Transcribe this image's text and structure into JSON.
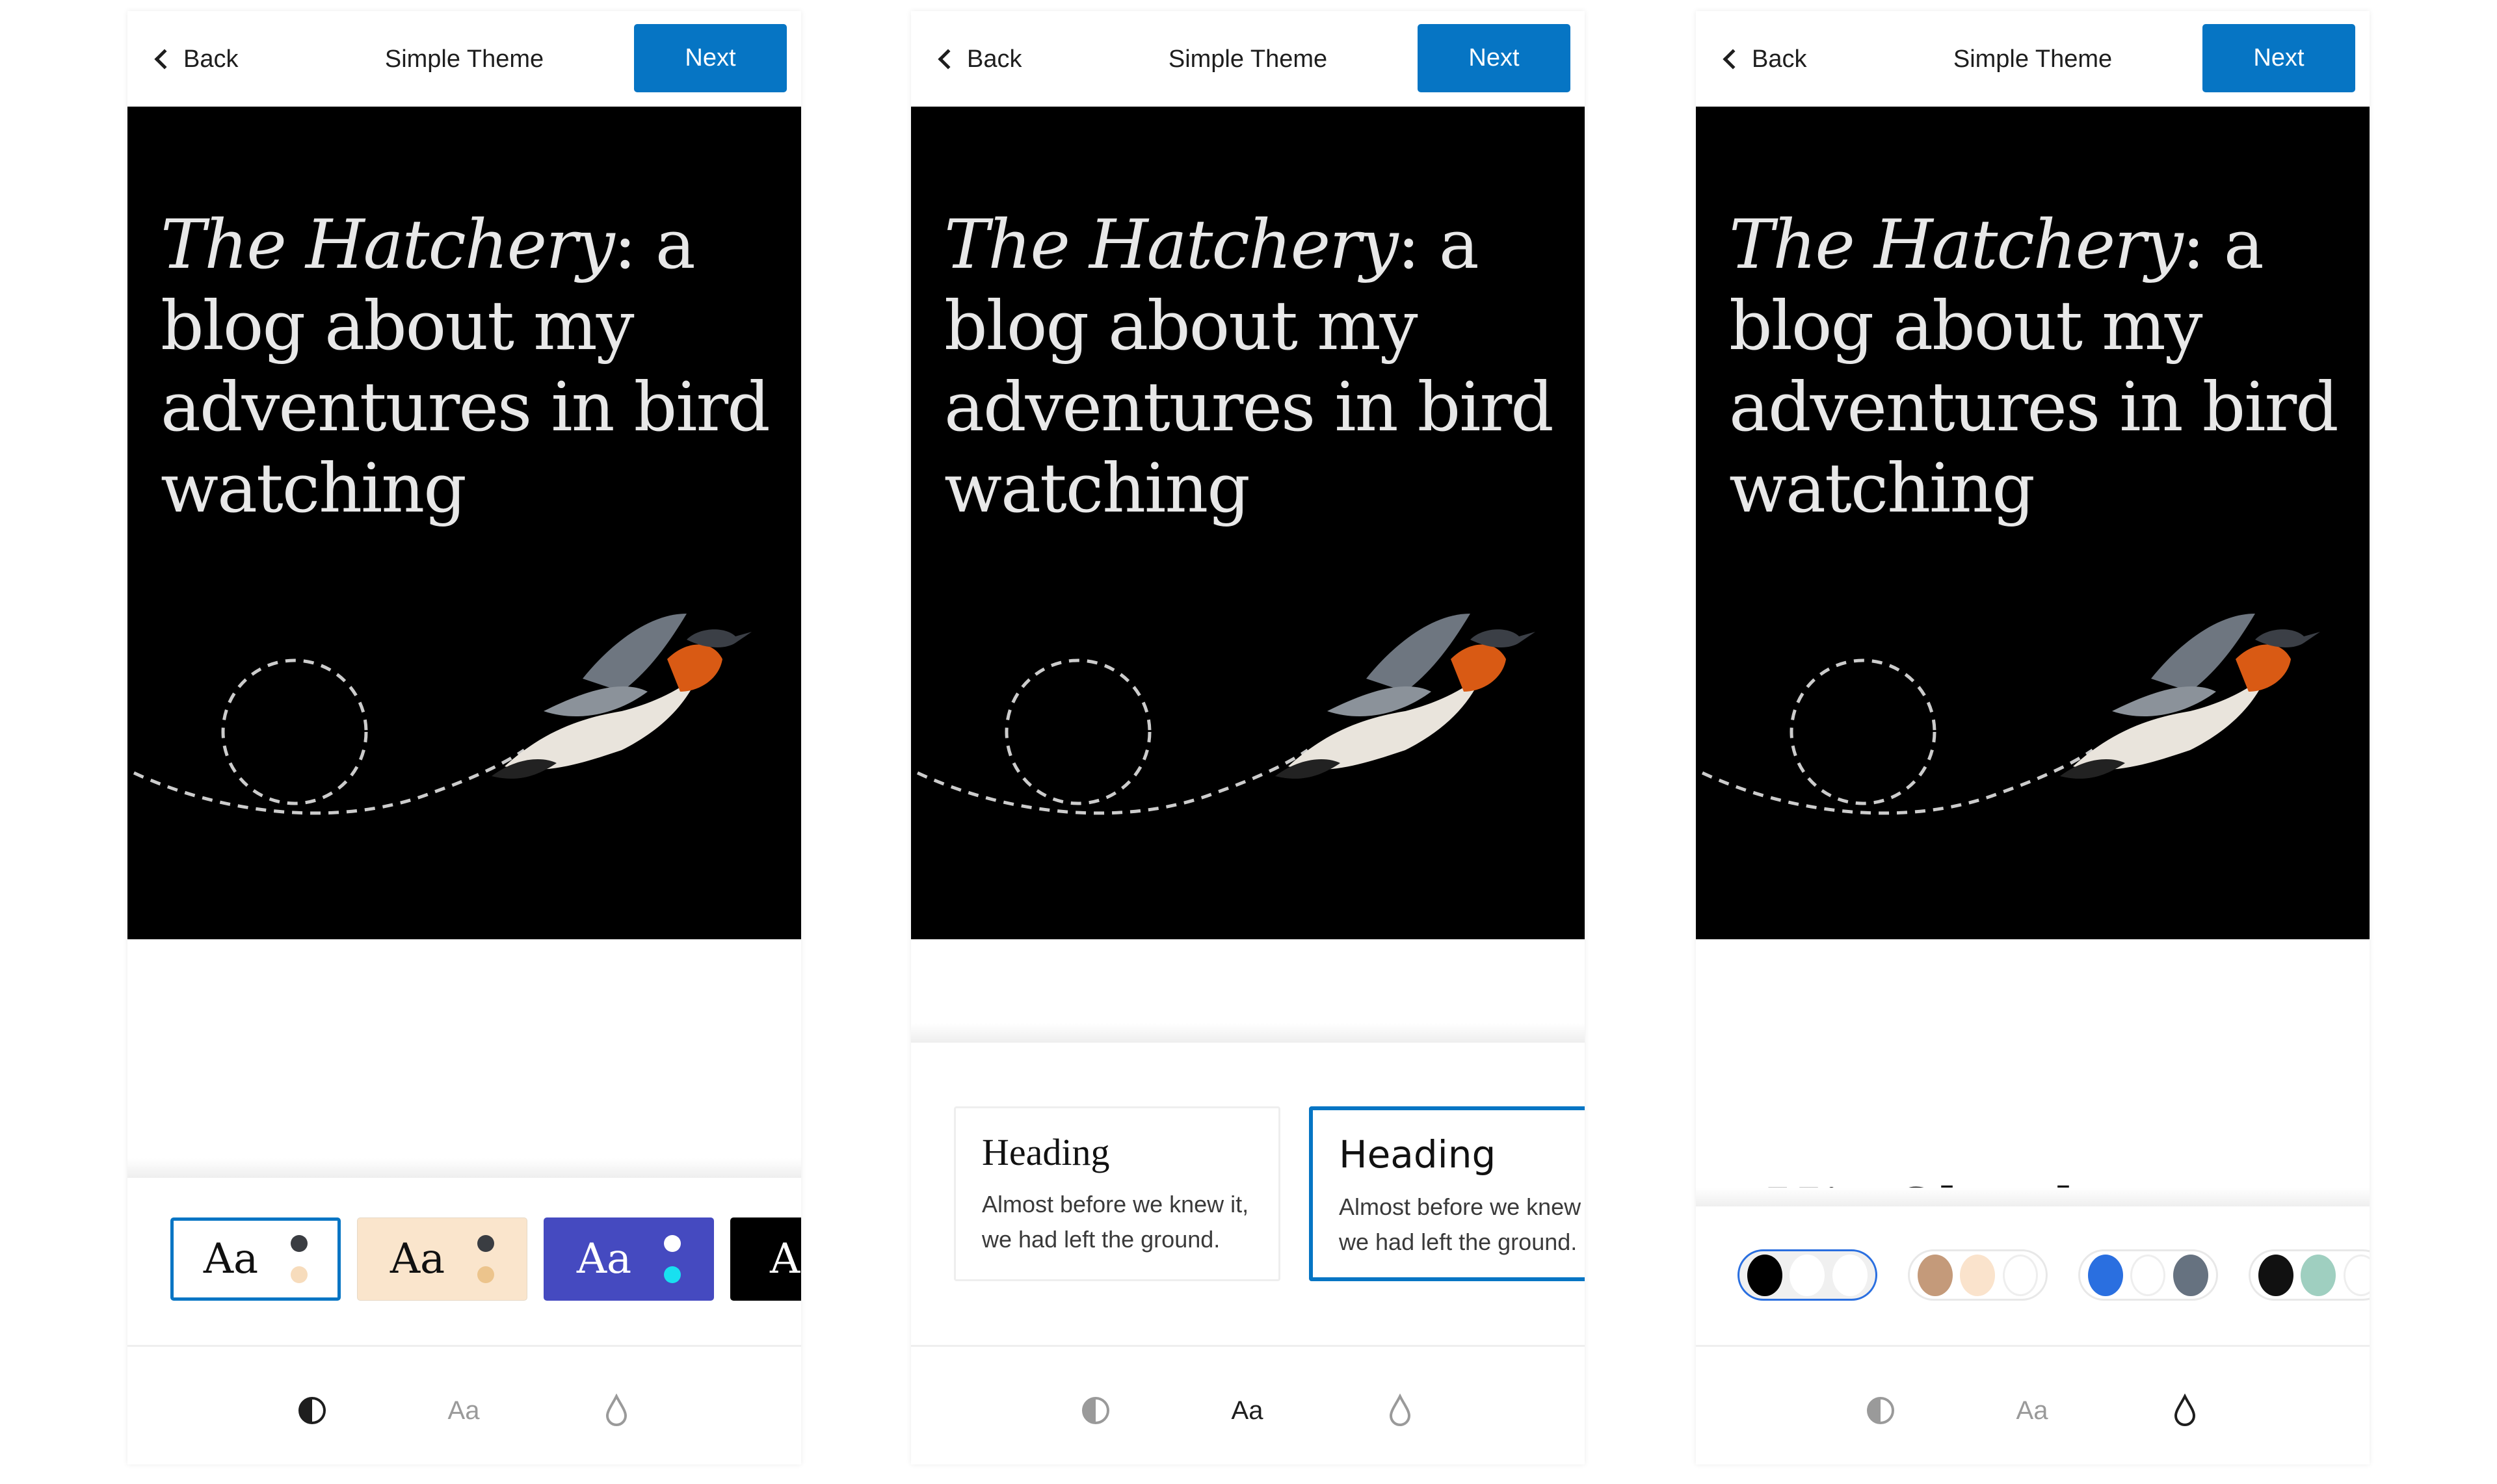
{
  "accent": "#0675c4",
  "panels": [
    {
      "header": {
        "back_label": "Back",
        "title": "Simple Theme",
        "next_label": "Next"
      },
      "hero": {
        "title_italic": "The Hatchery",
        "title_rest": ": a blog about my adventures in bird watching"
      },
      "mode": "styles",
      "styles": [
        {
          "label": "Aa",
          "bg": "#ffffff",
          "fg": "#111111",
          "dots": [
            "#3a3d42",
            "#f7dcbc"
          ],
          "selected": true
        },
        {
          "label": "Aa",
          "bg": "#fae5cc",
          "fg": "#111111",
          "dots": [
            "#3a3d42",
            "#ecc48c"
          ],
          "selected": false
        },
        {
          "label": "Aa",
          "bg": "#454ac0",
          "fg": "#ffffff",
          "dots": [
            "#ffffff",
            "#18e0f0"
          ],
          "selected": false
        },
        {
          "label": "Aa",
          "bg": "#000000",
          "fg": "#ffffff",
          "dots": [],
          "selected": false
        }
      ],
      "toolbar": {
        "active": "contrast-icon",
        "aa_label": "Aa"
      }
    },
    {
      "header": {
        "back_label": "Back",
        "title": "Simple Theme",
        "next_label": "Next"
      },
      "hero": {
        "title_italic": "The Hatchery",
        "title_rest": ": a blog about my adventures in bird watching"
      },
      "mode": "fonts",
      "fonts": [
        {
          "heading": "Heading",
          "body": "Almost before we knew it, we had left the ground.",
          "selected": false
        },
        {
          "heading": "Heading",
          "body": "Almost before we knew it, we had left the ground.",
          "selected": true
        }
      ],
      "toolbar": {
        "active": "typography-icon",
        "aa_label": "Aa"
      }
    },
    {
      "header": {
        "back_label": "Back",
        "title": "Simple Theme",
        "next_label": "Next"
      },
      "hero": {
        "title_italic": "The Hatchery",
        "title_rest": ": a blog about my adventures in bird watching"
      },
      "mode": "colors",
      "preview_text": "Hi! Check out my",
      "palettes": [
        {
          "colors": [
            "#000000",
            "#ffffff",
            "#ffffff"
          ],
          "selected": true
        },
        {
          "colors": [
            "#c49a7a",
            "#fae3cc",
            "#ffffff"
          ],
          "selected": false
        },
        {
          "colors": [
            "#2a6fe0",
            "#ffffff",
            "#667280"
          ],
          "selected": false
        },
        {
          "colors": [
            "#111111",
            "#9fcfc0",
            "#ffffff"
          ],
          "selected": false
        }
      ],
      "toolbar": {
        "active": "drop-icon",
        "aa_label": "Aa"
      }
    }
  ]
}
